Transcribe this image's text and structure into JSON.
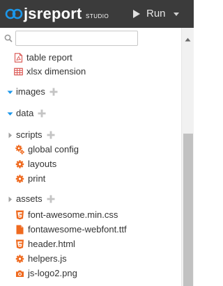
{
  "header": {
    "brand": "jsreport",
    "brand_sub": "STUDIO",
    "run_label": "Run"
  },
  "search": {
    "placeholder": "",
    "value": ""
  },
  "tree": {
    "reports_items": [
      {
        "label": "table report",
        "icon": "file-pdf-icon"
      },
      {
        "label": "xlsx dimension",
        "icon": "table-icon"
      }
    ],
    "folders": {
      "images": {
        "label": "images",
        "expanded": true
      },
      "data": {
        "label": "data",
        "expanded": true
      },
      "scripts": {
        "label": "scripts",
        "expanded": false
      },
      "assets": {
        "label": "assets",
        "expanded": false
      }
    },
    "scripts_items": [
      {
        "label": "global config",
        "icon": "cogs-icon"
      },
      {
        "label": "layouts",
        "icon": "gear-icon"
      },
      {
        "label": "print",
        "icon": "gear-icon"
      }
    ],
    "assets_items": [
      {
        "label": "font-awesome.min.css",
        "icon": "css3-icon"
      },
      {
        "label": "fontawesome-webfont.ttf",
        "icon": "file-icon"
      },
      {
        "label": "header.html",
        "icon": "html5-icon"
      },
      {
        "label": "helpers.js",
        "icon": "gear-icon"
      },
      {
        "label": "js-logo2.png",
        "icon": "camera-icon"
      }
    ]
  },
  "colors": {
    "topbar": "#3b3b3b",
    "brand_blue": "#1c97ea",
    "icon_orange": "#ef6a1f",
    "icon_red": "#d9534f",
    "plus_gray": "#c4c4c4",
    "folder_gray": "#777777"
  }
}
